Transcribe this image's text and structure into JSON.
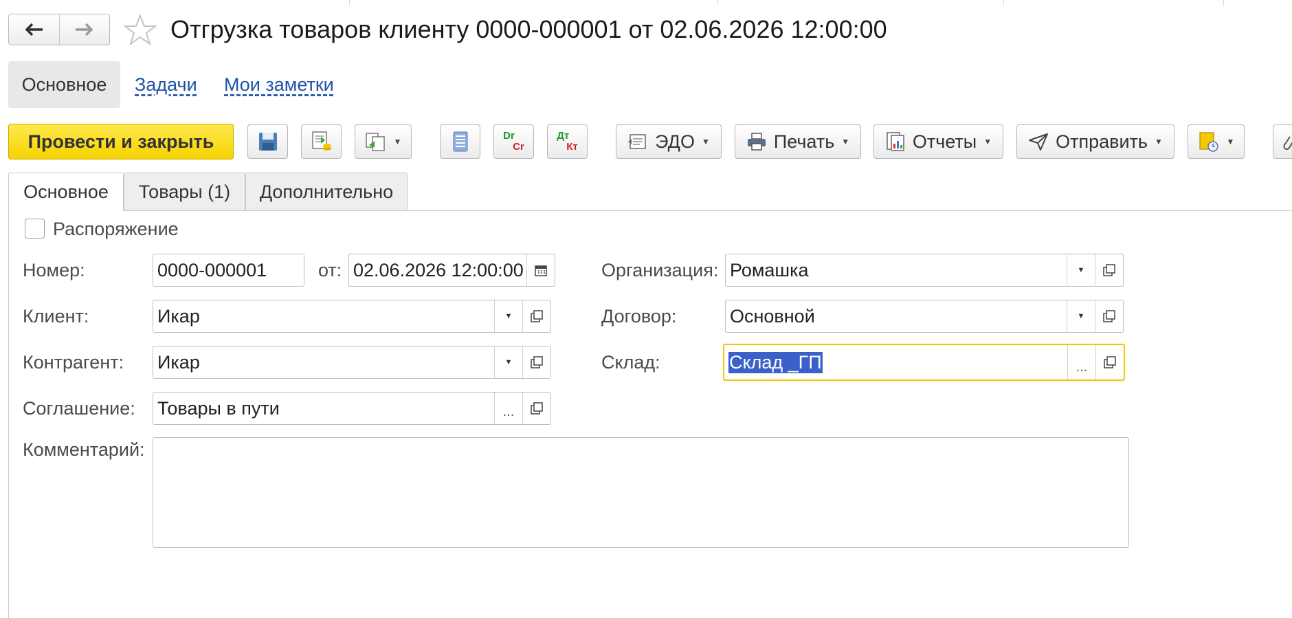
{
  "window": {
    "title": "Отгрузка товаров клиенту 0000-000001 от 02.06.2026 12:00:00"
  },
  "icons": [
    "arrow-left-icon",
    "arrow-right-icon",
    "star-icon",
    "save-icon",
    "post-icon",
    "create-based-on-icon",
    "structure-icon",
    "dr-cr-icon",
    "dt-kt-icon",
    "edo-icon",
    "printer-icon",
    "reports-icon",
    "send-icon",
    "attach-icon",
    "calendar-icon",
    "chevron-down-icon",
    "open-icon"
  ],
  "sections": {
    "main": "Основное",
    "tasks": "Задачи",
    "notes": "Мои заметки"
  },
  "toolbar": {
    "post_close": "Провести и закрыть",
    "dr": "Dr",
    "cr": "Cr",
    "dt": "Дт",
    "kt": "Кт",
    "edo": "ЭДО",
    "print": "Печать",
    "reports": "Отчеты",
    "send": "Отправить"
  },
  "form_tabs": [
    "Основное",
    "Товары (1)",
    "Дополнительно"
  ],
  "form": {
    "order_checkbox": {
      "label": "Распоряжение",
      "checked": false
    },
    "number": {
      "label": "Номер:",
      "value": "0000-000001"
    },
    "date": {
      "label": "от:",
      "value": "02.06.2026 12:00:00"
    },
    "client": {
      "label": "Клиент:",
      "value": "Икар"
    },
    "counterparty": {
      "label": "Контрагент:",
      "value": "Икар"
    },
    "agreement": {
      "label": "Соглашение:",
      "value": "Товары в пути"
    },
    "organization": {
      "label": "Организация:",
      "value": "Ромашка"
    },
    "contract": {
      "label": "Договор:",
      "value": "Основной"
    },
    "warehouse": {
      "label": "Склад:",
      "value": "Склад _ГП"
    },
    "comment": {
      "label": "Комментарий:",
      "value": ""
    }
  },
  "colors": {
    "primary_button": "#f5d200",
    "link": "#1f52a8",
    "focus_border": "#f2c600",
    "selection": "#3b61c8"
  }
}
